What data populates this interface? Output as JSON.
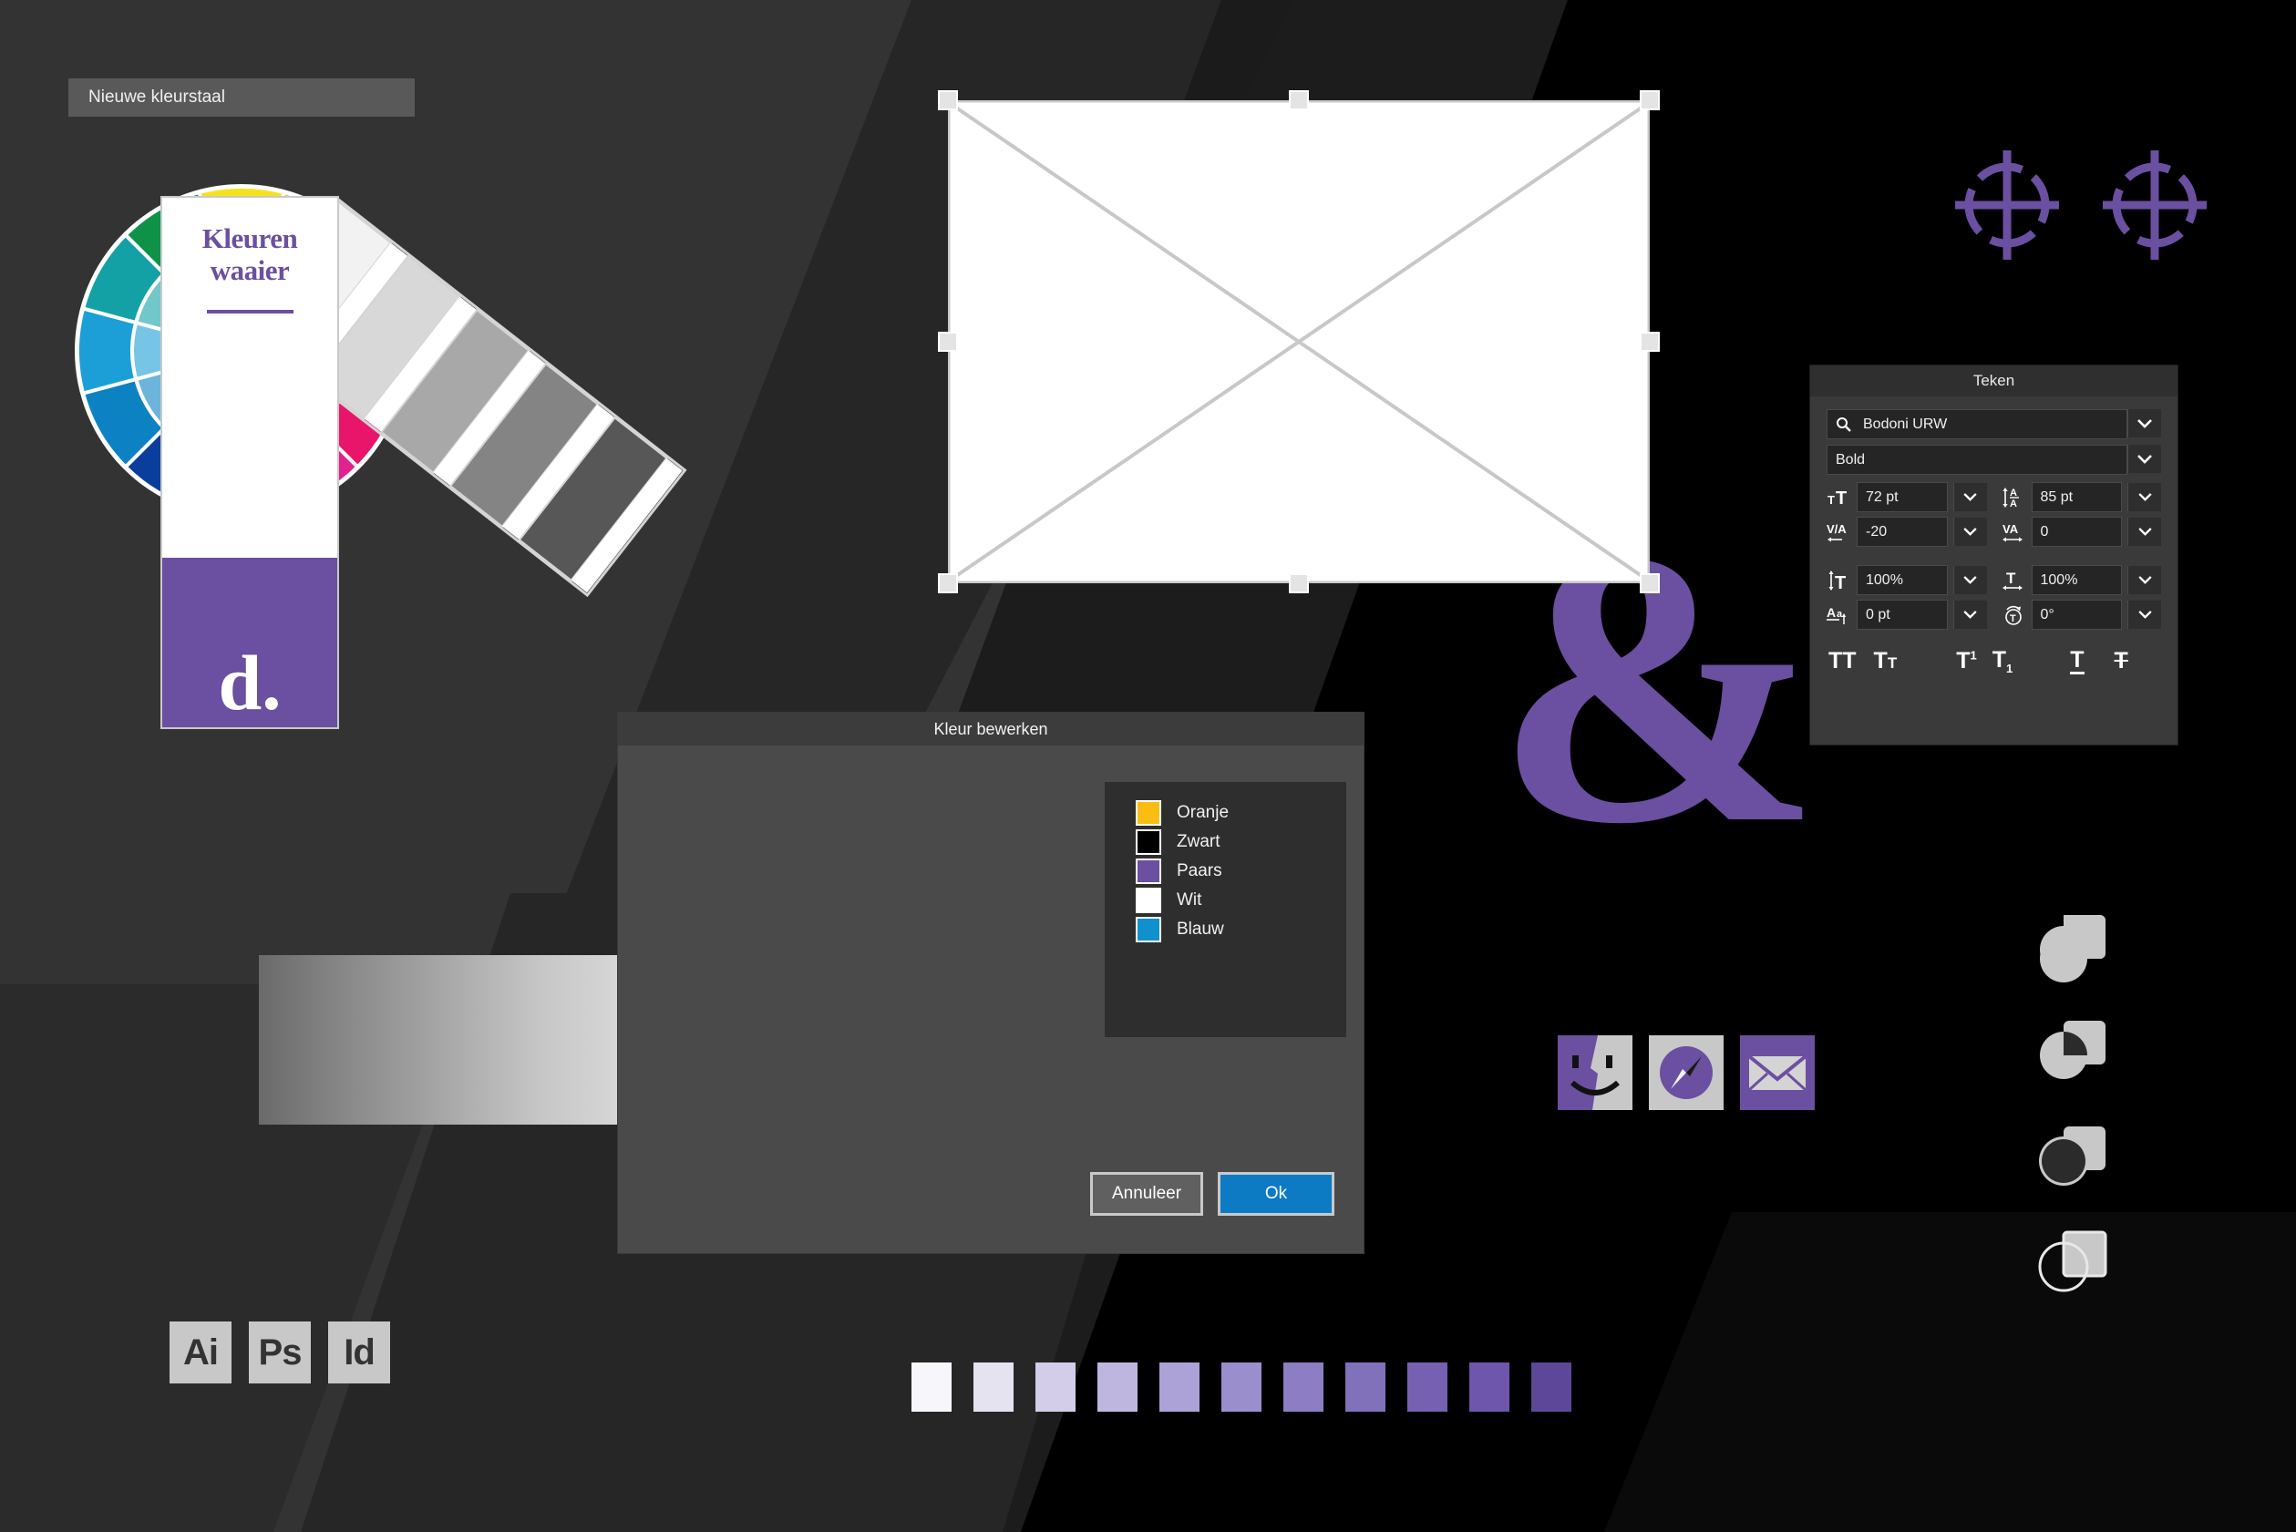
{
  "canvas": {
    "background": "#000000",
    "accent_purple": "#6B4FA0",
    "strata": [
      {
        "name": "dark-gray-top-left",
        "color": "#333333"
      },
      {
        "name": "near-black-diagonal",
        "color": "#1c1c1c"
      },
      {
        "name": "black-right",
        "color": "#000000"
      },
      {
        "name": "dark-gray-lower",
        "color": "#2b2b2b"
      }
    ]
  },
  "fan_card": {
    "title_line1": "Kleuren",
    "title_line2": "waaier",
    "logo": "d.",
    "logo_block_color": "#6B4FA0",
    "blades": [
      {
        "name": "blade-1",
        "color": "#f2f2f2"
      },
      {
        "name": "blade-2",
        "color": "#d8d8d8"
      },
      {
        "name": "blade-3",
        "color": "#a8a8a8"
      },
      {
        "name": "blade-4",
        "color": "#848484"
      },
      {
        "name": "blade-5",
        "color": "#575757"
      }
    ]
  },
  "gradient_bar": {
    "name": "grayscale-gradient",
    "from": "#6a6a6a",
    "to": "#d6d6d6"
  },
  "image_frame": {
    "name": "image-placeholder",
    "fill": "#ffffff",
    "handle_count": 8,
    "handle_color": "#e4e4e4"
  },
  "registration_marks": {
    "count": 2,
    "color": "#6B4FA0"
  },
  "ampersand": {
    "glyph": "&",
    "color": "#6B4FA0"
  },
  "teken_panel": {
    "title": "Teken",
    "font_family_value": "Bodoni URW",
    "font_style_value": "Bold",
    "fields": [
      {
        "icon": "font-size-icon",
        "label": "font-size",
        "value": "72 pt"
      },
      {
        "icon": "leading-icon",
        "label": "leading",
        "value": "85 pt"
      },
      {
        "icon": "kerning-icon",
        "label": "kerning",
        "value": "-20"
      },
      {
        "icon": "tracking-icon",
        "label": "tracking",
        "value": "0"
      },
      {
        "icon": "vertical-scale-icon",
        "label": "vertical-scale",
        "value": "100%"
      },
      {
        "icon": "horizontal-scale-icon",
        "label": "horizontal-scale",
        "value": "100%"
      },
      {
        "icon": "baseline-shift-icon",
        "label": "baseline-shift",
        "value": "0 pt"
      },
      {
        "icon": "character-rotation-icon",
        "label": "character-rotation",
        "value": "0°"
      }
    ],
    "style_buttons": [
      {
        "name": "all-caps-button",
        "glyph": "TT"
      },
      {
        "name": "small-caps-button",
        "glyph": "Tᴛ"
      },
      {
        "name": "superscript-button",
        "glyph": "T¹"
      },
      {
        "name": "subscript-button",
        "glyph": "T₁"
      },
      {
        "name": "underline-button",
        "glyph": "T"
      },
      {
        "name": "strikethrough-button",
        "glyph": "T"
      }
    ]
  },
  "dialog": {
    "title": "Kleur bewerken",
    "swatch_name_value": "Nieuwe kleurstaal",
    "swatch_name_placeholder": "Nieuwe kleurstaal",
    "cancel_label": "Annuleer",
    "ok_label": "Ok",
    "swatches": [
      {
        "label": "Oranje",
        "color": "#FBBD14"
      },
      {
        "label": "Zwart",
        "color": "#000000"
      },
      {
        "label": "Paars",
        "color": "#6B4FA0"
      },
      {
        "label": "Wit",
        "color": "#FFFFFF"
      },
      {
        "label": "Blauw",
        "color": "#1190CE"
      }
    ],
    "color_wheel": {
      "name": "color-wheel",
      "segments": 12,
      "rings": 3,
      "center_color": "#2e2e2e",
      "outer_ring": [
        "#F5E21C",
        "#FBB913",
        "#F07C12",
        "#EC1C3C",
        "#E8156B",
        "#E2208E",
        "#9A2392",
        "#3A2A8F",
        "#0A59A8",
        "#0C82C3",
        "#13A1A5",
        "#0E9247",
        "#8CBE37"
      ],
      "hues": [
        "yellow",
        "amber",
        "orange",
        "red",
        "crimson",
        "magenta",
        "purple",
        "indigo",
        "blue",
        "azure",
        "teal",
        "green",
        "yellow-green"
      ]
    }
  },
  "adobe_icons": [
    {
      "name": "illustrator-icon",
      "label": "Ai"
    },
    {
      "name": "photoshop-icon",
      "label": "Ps"
    },
    {
      "name": "indesign-icon",
      "label": "Id"
    }
  ],
  "mac_icons": [
    {
      "name": "finder-icon",
      "purple": "#6B4FA0",
      "gray": "#c8c8c8"
    },
    {
      "name": "safari-icon",
      "purple": "#6B4FA0",
      "gray": "#c8c8c8"
    },
    {
      "name": "mail-icon",
      "purple": "#6B4FA0",
      "gray": "#c8c8c8"
    }
  ],
  "purple_strip": [
    "#f7f6fa",
    "#e6e3f0",
    "#d3cdea",
    "#bfb6e0",
    "#ada2d7",
    "#9b8ecd",
    "#8d7dc4",
    "#8171bb",
    "#7560b2",
    "#6d56ab",
    "#5c4799"
  ],
  "pathfinder_icons": [
    {
      "name": "unite-icon"
    },
    {
      "name": "minus-front-icon"
    },
    {
      "name": "intersect-icon"
    },
    {
      "name": "outline-icon"
    }
  ]
}
